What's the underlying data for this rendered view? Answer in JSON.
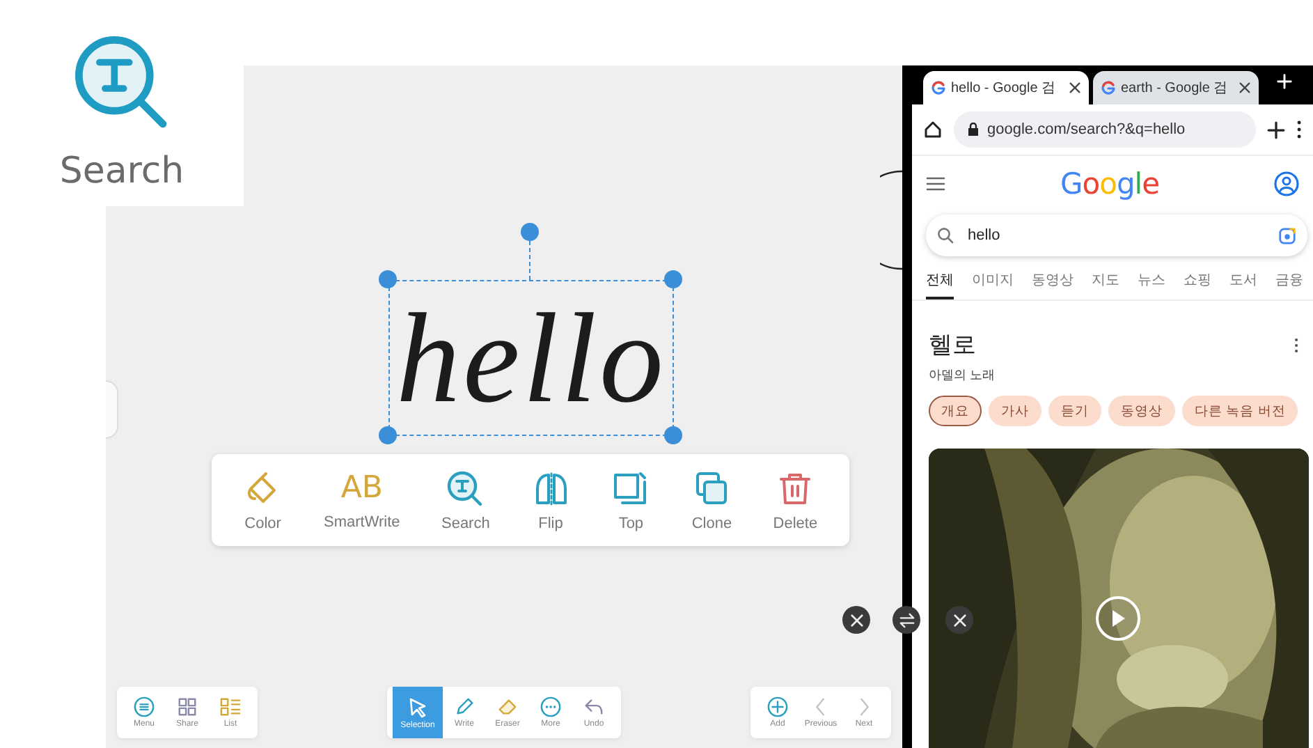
{
  "inset": {
    "label": "Search"
  },
  "canvas": {
    "handwriting": "hello",
    "selected": true
  },
  "context_menu": [
    {
      "kind": "color",
      "label": "Color"
    },
    {
      "kind": "smartwrite",
      "label": "SmartWrite",
      "icon_text": "AB"
    },
    {
      "kind": "search",
      "label": "Search"
    },
    {
      "kind": "flip",
      "label": "Flip"
    },
    {
      "kind": "top",
      "label": "Top"
    },
    {
      "kind": "clone",
      "label": "Clone"
    },
    {
      "kind": "delete",
      "label": "Delete"
    }
  ],
  "toolbars": [
    {
      "items": [
        {
          "kind": "menu",
          "label": "Menu",
          "selected": false
        },
        {
          "kind": "share",
          "label": "Share",
          "selected": false
        },
        {
          "kind": "list",
          "label": "List",
          "selected": false
        }
      ]
    },
    {
      "items": [
        {
          "kind": "selection",
          "label": "Selection",
          "selected": true
        },
        {
          "kind": "write",
          "label": "Write",
          "selected": false
        },
        {
          "kind": "eraser",
          "label": "Eraser",
          "selected": false
        },
        {
          "kind": "more",
          "label": "More",
          "selected": false
        },
        {
          "kind": "undo",
          "label": "Undo",
          "selected": false
        }
      ]
    },
    {
      "items": [
        {
          "kind": "add",
          "label": "Add",
          "selected": false
        },
        {
          "kind": "previous",
          "label": "Previous",
          "selected": false
        },
        {
          "kind": "next",
          "label": "Next",
          "selected": false
        }
      ]
    }
  ],
  "browser": {
    "tabs": [
      {
        "title": "hello - Google 검",
        "selected": true
      },
      {
        "title": "earth - Google 검",
        "selected": false
      }
    ],
    "url": "google.com/search?&q=hello",
    "logo": "Google",
    "search": {
      "value": "hello"
    },
    "filters": [
      {
        "label": "전체",
        "selected": true
      },
      {
        "label": "이미지",
        "selected": false
      },
      {
        "label": "동영상",
        "selected": false
      },
      {
        "label": "지도",
        "selected": false
      },
      {
        "label": "뉴스",
        "selected": false
      },
      {
        "label": "쇼핑",
        "selected": false
      },
      {
        "label": "도서",
        "selected": false
      },
      {
        "label": "금융",
        "selected": false
      }
    ],
    "result": {
      "title": "헬로",
      "subtitle": "아델의 노래",
      "chips": [
        {
          "label": "개요",
          "selected": true
        },
        {
          "label": "가사",
          "selected": false
        },
        {
          "label": "듣기",
          "selected": false
        },
        {
          "label": "동영상",
          "selected": false
        },
        {
          "label": "다른 녹음 버전",
          "selected": false
        }
      ]
    }
  }
}
